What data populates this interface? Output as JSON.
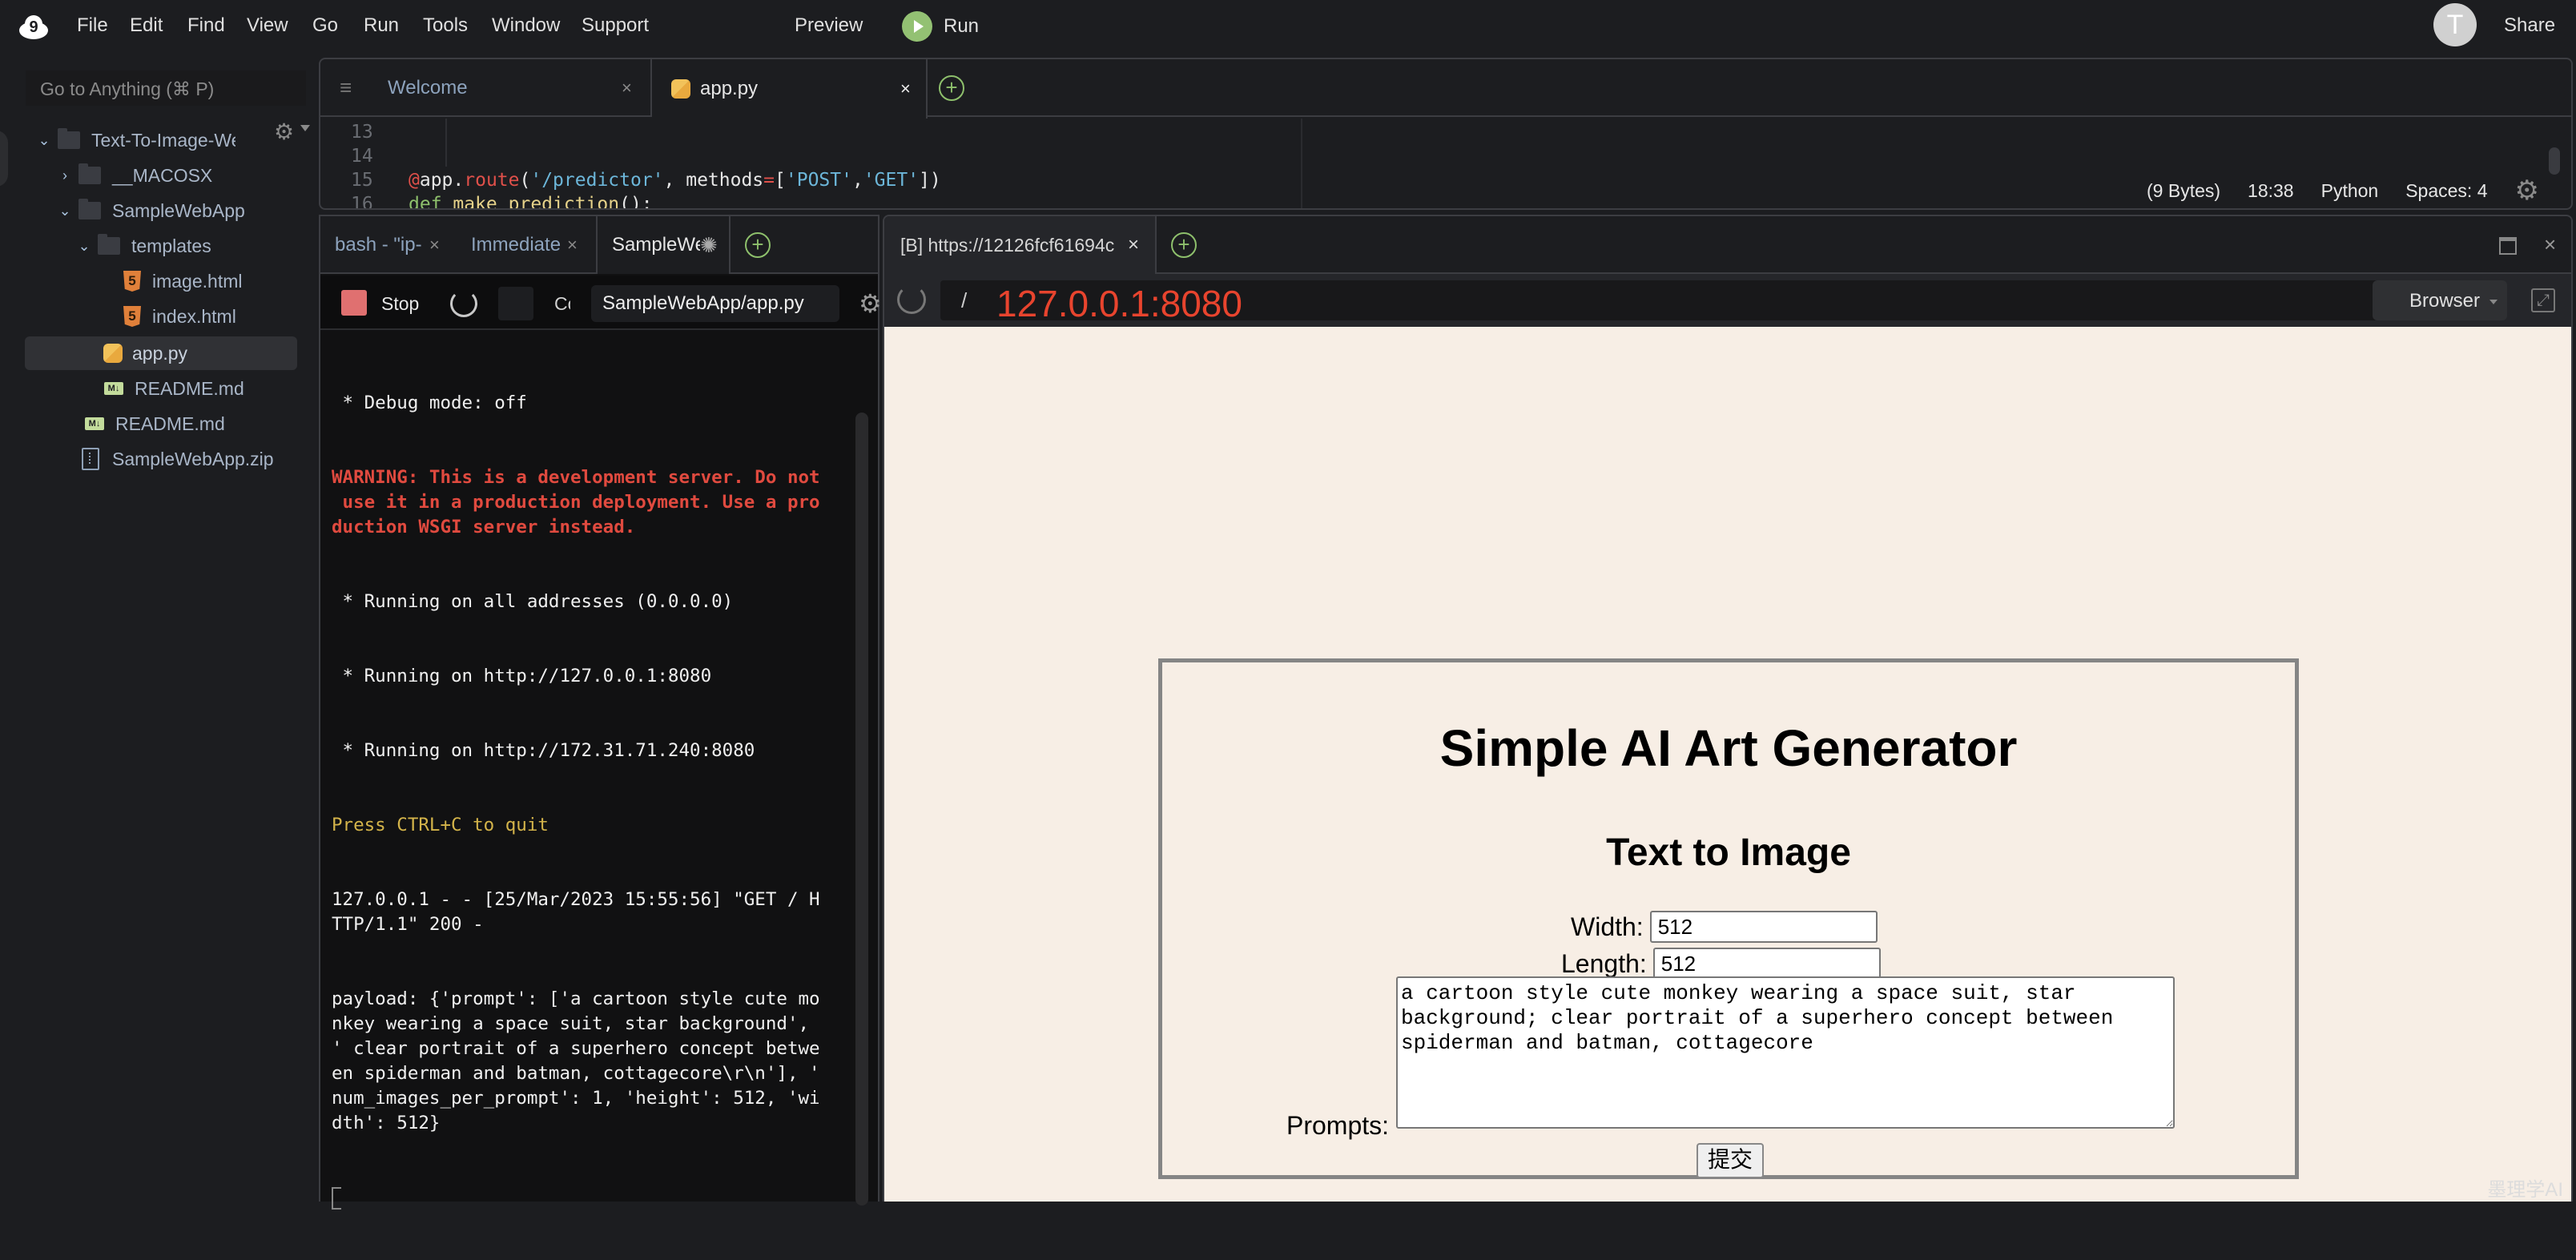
{
  "menubar": {
    "items": [
      "File",
      "Edit",
      "Find",
      "View",
      "Go",
      "Run",
      "Tools",
      "Window",
      "Support"
    ],
    "preview_label": "Preview",
    "run_label": "Run",
    "avatar_initial": "T",
    "share_label": "Share"
  },
  "sidebar": {
    "goto_placeholder": "Go to Anything (⌘ P)",
    "tree": [
      {
        "label": "Text-To-Image-Web",
        "type": "folder",
        "expanded": true,
        "depth": 0
      },
      {
        "label": "__MACOSX",
        "type": "folder",
        "expanded": false,
        "depth": 1
      },
      {
        "label": "SampleWebApp",
        "type": "folder",
        "expanded": true,
        "depth": 1
      },
      {
        "label": "templates",
        "type": "folder",
        "expanded": true,
        "depth": 2
      },
      {
        "label": "image.html",
        "type": "html",
        "depth": 3
      },
      {
        "label": "index.html",
        "type": "html",
        "depth": 3
      },
      {
        "label": "app.py",
        "type": "python",
        "depth": 2,
        "selected": true
      },
      {
        "label": "README.md",
        "type": "markdown",
        "depth": 2
      },
      {
        "label": "README.md",
        "type": "markdown",
        "depth": 1
      },
      {
        "label": "SampleWebApp.zip",
        "type": "zip",
        "depth": 1
      }
    ]
  },
  "editor": {
    "tabs": [
      {
        "label": "Welcome",
        "active": false
      },
      {
        "label": "app.py",
        "active": true
      }
    ],
    "lines": [
      {
        "num": "13",
        "code": ""
      },
      {
        "num": "14",
        "code": ""
      },
      {
        "num": "15",
        "decorator": "@",
        "obj": "app.",
        "func": "route",
        "open": "(",
        "path": "'/predictor'",
        "mid": ", methods",
        "eq": "=",
        "list_open": "[",
        "m1": "'POST'",
        "comma": ",",
        "m2": "'GET'",
        "close": "])"
      },
      {
        "num": "16",
        "kw": "def",
        "fname": " make_prediction",
        "rest": "():"
      }
    ],
    "status": {
      "size": "(9 Bytes)",
      "cursor": "18:38",
      "language": "Python",
      "indent": "Spaces: 4"
    }
  },
  "terminal": {
    "tabs": [
      {
        "label": "bash - \"ip-",
        "closable": true
      },
      {
        "label": "Immediate",
        "closable": true
      },
      {
        "label": "SampleWe",
        "active": true,
        "loading": true
      }
    ],
    "stop_label": "Stop",
    "cmd_label": "Command",
    "cmd_value": "SampleWebApp/app.py",
    "output": [
      {
        "text": " * Debug mode: off",
        "style": "normal"
      },
      {
        "text": "WARNING: This is a development server. Do not\n use it in a production deployment. Use a pro\nduction WSGI server instead.",
        "style": "red"
      },
      {
        "text": " * Running on all addresses (0.0.0.0)",
        "style": "normal"
      },
      {
        "text": " * Running on http://127.0.0.1:8080",
        "style": "normal"
      },
      {
        "text": " * Running on http://172.31.71.240:8080",
        "style": "normal"
      },
      {
        "text": "Press CTRL+C to quit",
        "style": "yellow"
      },
      {
        "text": "127.0.0.1 - - [25/Mar/2023 15:55:56] \"GET / H\nTTP/1.1\" 200 -",
        "style": "normal"
      },
      {
        "text": "payload: {'prompt': ['a cartoon style cute mo\nnkey wearing a space suit, star background',\n' clear portrait of a superhero concept betwe\nen spiderman and batman, cottagecore\\r\\n'], '\nnum_images_per_prompt': 1, 'height': 512, 'wi\ndth': 512}",
        "style": "normal"
      }
    ]
  },
  "browser": {
    "tab_label": "[B] https://12126fcf61694c",
    "url_prefix": "/",
    "url": "127.0.0.1:8080",
    "mode_label": "Browser",
    "page": {
      "title": "Simple AI Art Generator",
      "subtitle": "Text to Image",
      "width_label": "Width:",
      "width_value": "512",
      "length_label": "Length:",
      "length_value": "512",
      "prompts_label": "Prompts:",
      "prompts_value": "a cartoon style cute monkey wearing a space suit, star background; clear portrait of a superhero concept between spiderman and batman, cottagecore",
      "submit_label": "提交"
    },
    "watermark": "墨理学AI"
  },
  "colors": {
    "accent_green": "#93c173",
    "url_red": "#e8442e",
    "warning_red": "#e04a3f",
    "quit_yellow": "#d4b44a",
    "page_bg": "#f7eee5"
  }
}
